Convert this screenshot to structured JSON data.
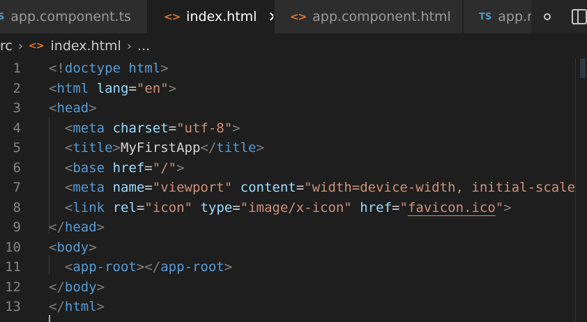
{
  "tabs": [
    {
      "label": "app.component.ts",
      "icon": "ts-file-icon",
      "active": false
    },
    {
      "label": "index.html",
      "icon": "html-file-icon",
      "active": true
    },
    {
      "label": "app.component.html",
      "icon": "html-file-icon",
      "active": false
    },
    {
      "label": "app.m",
      "icon": "ts-file-icon",
      "active": false
    }
  ],
  "icons": {
    "html": "<>",
    "ts": "TS",
    "close": "✕"
  },
  "breadcrumb": {
    "folder": "rc",
    "file": "index.html",
    "more": "..."
  },
  "lines": [
    {
      "n": "1",
      "tokens": [
        [
          "p",
          "<!"
        ],
        [
          "tag",
          "doctype"
        ],
        [
          "txt",
          " "
        ],
        [
          "tag",
          "html"
        ],
        [
          "p",
          ">"
        ]
      ]
    },
    {
      "n": "2",
      "tokens": [
        [
          "p",
          "<"
        ],
        [
          "tag",
          "html"
        ],
        [
          "txt",
          " "
        ],
        [
          "attr",
          "lang"
        ],
        [
          "txt",
          "="
        ],
        [
          "str",
          "\"en\""
        ],
        [
          "p",
          ">"
        ]
      ]
    },
    {
      "n": "3",
      "tokens": [
        [
          "p",
          "<"
        ],
        [
          "tag",
          "head"
        ],
        [
          "p",
          ">"
        ]
      ]
    },
    {
      "n": "4",
      "tokens": [
        [
          "txt",
          "  "
        ],
        [
          "p",
          "<"
        ],
        [
          "tag",
          "meta"
        ],
        [
          "txt",
          " "
        ],
        [
          "attr",
          "charset"
        ],
        [
          "txt",
          "="
        ],
        [
          "str",
          "\"utf-8\""
        ],
        [
          "p",
          ">"
        ]
      ]
    },
    {
      "n": "5",
      "tokens": [
        [
          "txt",
          "  "
        ],
        [
          "p",
          "<"
        ],
        [
          "tag",
          "title"
        ],
        [
          "p",
          ">"
        ],
        [
          "txt",
          "MyFirstApp"
        ],
        [
          "p",
          "</"
        ],
        [
          "tag",
          "title"
        ],
        [
          "p",
          ">"
        ]
      ]
    },
    {
      "n": "6",
      "tokens": [
        [
          "txt",
          "  "
        ],
        [
          "p",
          "<"
        ],
        [
          "tag",
          "base"
        ],
        [
          "txt",
          " "
        ],
        [
          "attr",
          "href"
        ],
        [
          "txt",
          "="
        ],
        [
          "str",
          "\"/\""
        ],
        [
          "p",
          ">"
        ]
      ]
    },
    {
      "n": "7",
      "tokens": [
        [
          "txt",
          "  "
        ],
        [
          "p",
          "<"
        ],
        [
          "tag",
          "meta"
        ],
        [
          "txt",
          " "
        ],
        [
          "attr",
          "name"
        ],
        [
          "txt",
          "="
        ],
        [
          "str",
          "\"viewport\""
        ],
        [
          "txt",
          " "
        ],
        [
          "attr",
          "content"
        ],
        [
          "txt",
          "="
        ],
        [
          "str",
          "\"width=device-width, initial-scale"
        ]
      ]
    },
    {
      "n": "8",
      "tokens": [
        [
          "txt",
          "  "
        ],
        [
          "p",
          "<"
        ],
        [
          "tag",
          "link"
        ],
        [
          "txt",
          " "
        ],
        [
          "attr",
          "rel"
        ],
        [
          "txt",
          "="
        ],
        [
          "str",
          "\"icon\""
        ],
        [
          "txt",
          " "
        ],
        [
          "attr",
          "type"
        ],
        [
          "txt",
          "="
        ],
        [
          "str",
          "\"image/x-icon\""
        ],
        [
          "txt",
          " "
        ],
        [
          "attr",
          "href"
        ],
        [
          "txt",
          "="
        ],
        [
          "str",
          "\""
        ],
        [
          "strsq",
          "favicon.ico"
        ],
        [
          "str",
          "\""
        ],
        [
          "p",
          ">"
        ]
      ]
    },
    {
      "n": "9",
      "tokens": [
        [
          "p",
          "</"
        ],
        [
          "tag",
          "head"
        ],
        [
          "p",
          ">"
        ]
      ]
    },
    {
      "n": "10",
      "tokens": [
        [
          "p",
          "<"
        ],
        [
          "tag",
          "body"
        ],
        [
          "p",
          ">"
        ]
      ]
    },
    {
      "n": "11",
      "tokens": [
        [
          "txt",
          "  "
        ],
        [
          "p",
          "<"
        ],
        [
          "tag",
          "app-root"
        ],
        [
          "p",
          "></"
        ],
        [
          "tag",
          "app-root"
        ],
        [
          "p",
          ">"
        ]
      ]
    },
    {
      "n": "12",
      "tokens": [
        [
          "p",
          "</"
        ],
        [
          "tag",
          "body"
        ],
        [
          "p",
          ">"
        ]
      ]
    },
    {
      "n": "13",
      "tokens": [
        [
          "p",
          "</"
        ],
        [
          "tag",
          "html"
        ],
        [
          "p",
          ">"
        ]
      ]
    }
  ]
}
